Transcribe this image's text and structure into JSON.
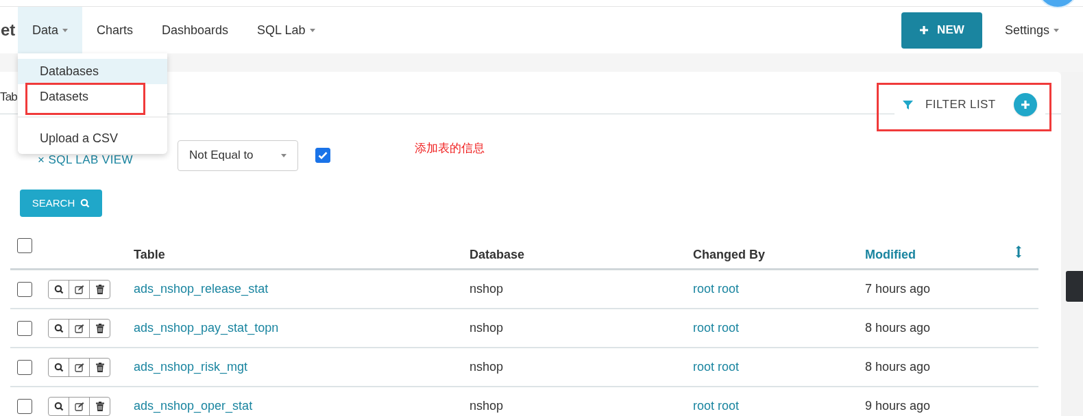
{
  "logo": "et",
  "nav": {
    "items": [
      {
        "label": "Data",
        "caret": true,
        "selected": true
      },
      {
        "label": "Charts",
        "caret": false,
        "selected": false
      },
      {
        "label": "Dashboards",
        "caret": false,
        "selected": false
      },
      {
        "label": "SQL Lab",
        "caret": true,
        "selected": false
      }
    ],
    "new_button": "NEW",
    "settings": "Settings"
  },
  "dropdown": {
    "items": [
      {
        "label": "Databases",
        "selected": true,
        "divider_after": false
      },
      {
        "label": "Datasets",
        "selected": false,
        "divider_after": true
      },
      {
        "label": "Upload a CSV",
        "selected": false,
        "divider_after": false
      }
    ]
  },
  "tab_title": "Tab",
  "filter_list": "FILTER LIST",
  "annotation": "添加表的信息",
  "filter": {
    "label": "× SQL LAB VIEW",
    "operator": "Not Equal to",
    "checked": true
  },
  "search_button": "SEARCH",
  "table": {
    "select_all_checked": false,
    "columns": [
      {
        "label": "Table",
        "sorted": false
      },
      {
        "label": "Database",
        "sorted": false
      },
      {
        "label": "Changed By",
        "sorted": false
      },
      {
        "label": "Modified",
        "sorted": true
      }
    ],
    "rows": [
      {
        "checked": false,
        "table": "ads_nshop_release_stat",
        "database": "nshop",
        "changed_by": "root root",
        "modified": "7 hours ago"
      },
      {
        "checked": false,
        "table": "ads_nshop_pay_stat_topn",
        "database": "nshop",
        "changed_by": "root root",
        "modified": "8 hours ago"
      },
      {
        "checked": false,
        "table": "ads_nshop_risk_mgt",
        "database": "nshop",
        "changed_by": "root root",
        "modified": "8 hours ago"
      },
      {
        "checked": false,
        "table": "ads_nshop_oper_stat",
        "database": "nshop",
        "changed_by": "root root",
        "modified": "9 hours ago"
      }
    ]
  }
}
